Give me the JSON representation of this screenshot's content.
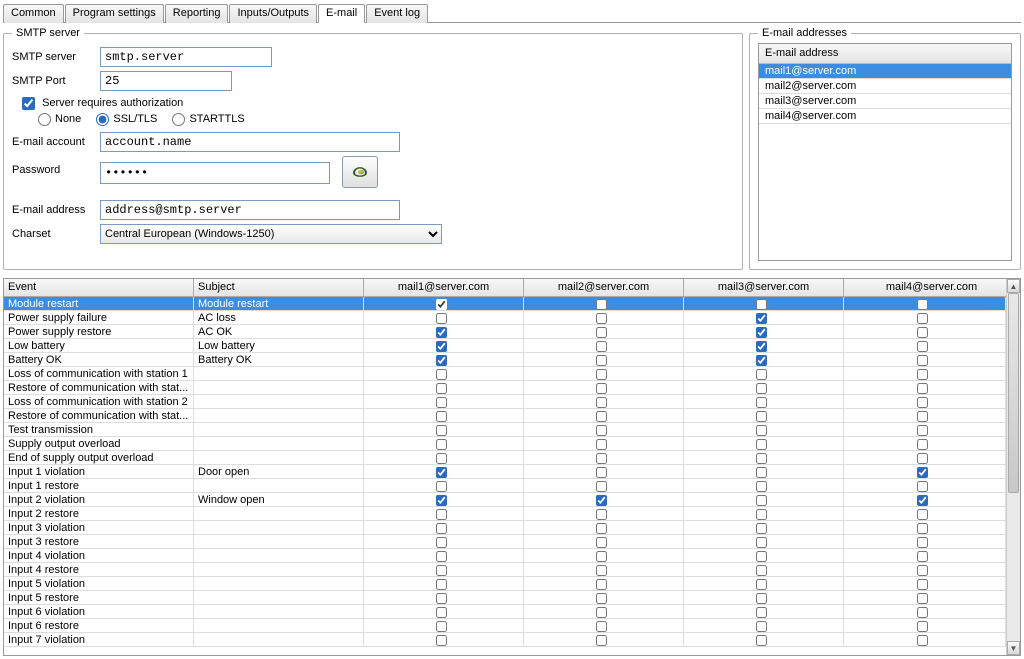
{
  "tabs": [
    "Common",
    "Program settings",
    "Reporting",
    "Inputs/Outputs",
    "E-mail",
    "Event log"
  ],
  "active_tab": 4,
  "smtp": {
    "legend": "SMTP server",
    "server_label": "SMTP server",
    "server_value": "smtp.server",
    "port_label": "SMTP Port",
    "port_value": "25",
    "auth_label": "Server requires authorization",
    "radios": {
      "none": "None",
      "ssl": "SSL/TLS",
      "start": "STARTTLS"
    },
    "account_label": "E-mail account",
    "account_value": "account.name",
    "password_label": "Password",
    "password_value": "••••••",
    "address_label": "E-mail address",
    "address_value": "address@smtp.server",
    "charset_label": "Charset",
    "charset_value": "Central European (Windows-1250)"
  },
  "addresses": {
    "legend": "E-mail addresses",
    "header": "E-mail address",
    "items": [
      "mail1@server.com",
      "mail2@server.com",
      "mail3@server.com",
      "mail4@server.com"
    ]
  },
  "grid": {
    "headers": {
      "event": "Event",
      "subject": "Subject",
      "m1": "mail1@server.com",
      "m2": "mail2@server.com",
      "m3": "mail3@server.com",
      "m4": "mail4@server.com"
    },
    "rows": [
      {
        "event": "Module restart",
        "subject": "Module restart",
        "m": [
          true,
          false,
          false,
          false
        ],
        "sel": true
      },
      {
        "event": "Power supply failure",
        "subject": "AC loss",
        "m": [
          false,
          false,
          true,
          false
        ]
      },
      {
        "event": "Power supply restore",
        "subject": "AC OK",
        "m": [
          true,
          false,
          true,
          false
        ]
      },
      {
        "event": "Low battery",
        "subject": "Low battery",
        "m": [
          true,
          false,
          true,
          false
        ]
      },
      {
        "event": "Battery OK",
        "subject": "Battery OK",
        "m": [
          true,
          false,
          true,
          false
        ]
      },
      {
        "event": "Loss of communication with station 1",
        "subject": "",
        "m": [
          false,
          false,
          false,
          false
        ]
      },
      {
        "event": "Restore of communication with stat...",
        "subject": "",
        "m": [
          false,
          false,
          false,
          false
        ]
      },
      {
        "event": "Loss of communication with station 2",
        "subject": "",
        "m": [
          false,
          false,
          false,
          false
        ]
      },
      {
        "event": "Restore of communication with stat...",
        "subject": "",
        "m": [
          false,
          false,
          false,
          false
        ]
      },
      {
        "event": "Test transmission",
        "subject": "",
        "m": [
          false,
          false,
          false,
          false
        ]
      },
      {
        "event": "Supply output overload",
        "subject": "",
        "m": [
          false,
          false,
          false,
          false
        ]
      },
      {
        "event": "End of supply output overload",
        "subject": "",
        "m": [
          false,
          false,
          false,
          false
        ]
      },
      {
        "event": "Input 1 violation",
        "subject": "Door open",
        "m": [
          true,
          false,
          false,
          true
        ]
      },
      {
        "event": "Input 1 restore",
        "subject": "",
        "m": [
          false,
          false,
          false,
          false
        ]
      },
      {
        "event": "Input 2 violation",
        "subject": "Window open",
        "m": [
          true,
          true,
          false,
          true
        ]
      },
      {
        "event": "Input 2 restore",
        "subject": "",
        "m": [
          false,
          false,
          false,
          false
        ]
      },
      {
        "event": "Input 3 violation",
        "subject": "",
        "m": [
          false,
          false,
          false,
          false
        ]
      },
      {
        "event": "Input 3 restore",
        "subject": "",
        "m": [
          false,
          false,
          false,
          false
        ]
      },
      {
        "event": "Input 4 violation",
        "subject": "",
        "m": [
          false,
          false,
          false,
          false
        ]
      },
      {
        "event": "Input 4 restore",
        "subject": "",
        "m": [
          false,
          false,
          false,
          false
        ]
      },
      {
        "event": "Input 5 violation",
        "subject": "",
        "m": [
          false,
          false,
          false,
          false
        ]
      },
      {
        "event": "Input 5 restore",
        "subject": "",
        "m": [
          false,
          false,
          false,
          false
        ]
      },
      {
        "event": "Input 6 violation",
        "subject": "",
        "m": [
          false,
          false,
          false,
          false
        ]
      },
      {
        "event": "Input 6 restore",
        "subject": "",
        "m": [
          false,
          false,
          false,
          false
        ]
      },
      {
        "event": "Input 7 violation",
        "subject": "",
        "m": [
          false,
          false,
          false,
          false
        ]
      }
    ]
  }
}
